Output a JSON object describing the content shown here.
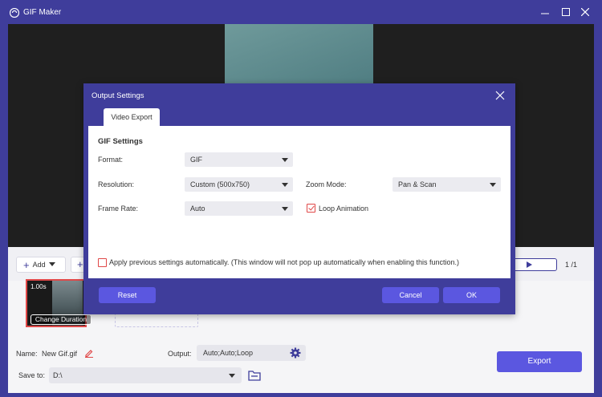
{
  "window": {
    "title": "GIF Maker"
  },
  "toolbar": {
    "add_label": "Add",
    "page_count": "1 /1"
  },
  "thumbnail": {
    "duration": "1.00s",
    "change_duration_label": "Change Duration"
  },
  "bottom": {
    "name_label": "Name:",
    "name_value": "New Gif.gif",
    "output_label": "Output:",
    "output_value": "Auto;Auto;Loop",
    "save_to_label": "Save to:",
    "save_to_value": "D:\\",
    "export_label": "Export"
  },
  "dialog": {
    "title": "Output Settings",
    "tab_label": "Video Export",
    "section_title": "GIF Settings",
    "format_label": "Format:",
    "format_value": "GIF",
    "resolution_label": "Resolution:",
    "resolution_value": "Custom (500x750)",
    "zoom_label": "Zoom Mode:",
    "zoom_value": "Pan & Scan",
    "framerate_label": "Frame Rate:",
    "framerate_value": "Auto",
    "loop_label": "Loop Animation",
    "loop_checked": true,
    "apply_label": "Apply previous settings automatically. (This window will not pop up automatically when enabling this function.)",
    "apply_checked": false,
    "reset_label": "Reset",
    "cancel_label": "Cancel",
    "ok_label": "OK"
  },
  "colors": {
    "accent": "#3f3d9b",
    "button": "#5b57e0",
    "check": "#e04848"
  }
}
